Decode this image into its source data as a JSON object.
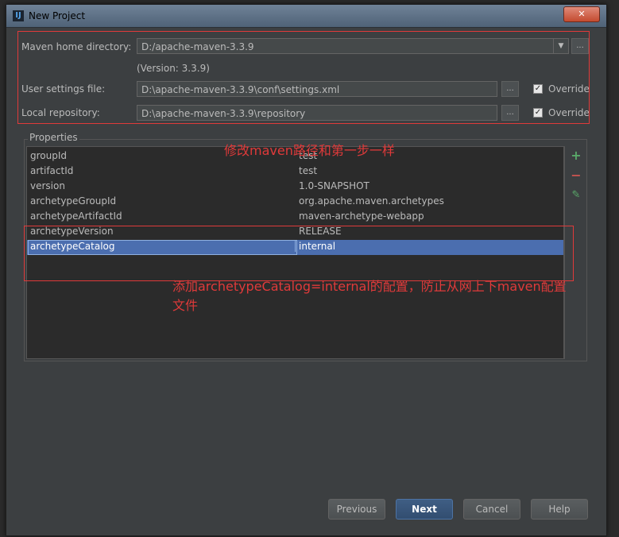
{
  "window": {
    "title": "New Project",
    "app_icon": "IJ",
    "close_label": "✕"
  },
  "maven": {
    "home_label": "Maven home directory:",
    "home_value": "D:/apache-maven-3.3.9",
    "version_text": "(Version: 3.3.9)",
    "settings_label": "User settings file:",
    "settings_value": "D:\\apache-maven-3.3.9\\conf\\settings.xml",
    "repo_label": "Local repository:",
    "repo_value": "D:\\apache-maven-3.3.9\\repository",
    "override_label": "Override",
    "browse_label": "...",
    "dropdown_icon": "▼"
  },
  "properties": {
    "title": "Properties",
    "rows": [
      {
        "key": "groupId",
        "value": "test"
      },
      {
        "key": "artifactId",
        "value": "test"
      },
      {
        "key": "version",
        "value": "1.0-SNAPSHOT"
      },
      {
        "key": "archetypeGroupId",
        "value": "org.apache.maven.archetypes"
      },
      {
        "key": "archetypeArtifactId",
        "value": "maven-archetype-webapp"
      },
      {
        "key": "archetypeVersion",
        "value": "RELEASE"
      },
      {
        "key": "archetypeCatalog",
        "value": "internal"
      }
    ],
    "add_icon": "+",
    "remove_icon": "−",
    "edit_icon": "✎"
  },
  "annotations": {
    "note1": "修改maven路径和第一步一样",
    "note2_line1": "添加archetypeCatalog=internal的配置，防止从网上下maven配置",
    "note2_line2": "文件"
  },
  "buttons": {
    "previous": "Previous",
    "next": "Next",
    "cancel": "Cancel",
    "help": "Help"
  },
  "colors": {
    "accent_selection": "#4b6eaf",
    "annotation_red": "#e03a3a",
    "add_green": "#59a869",
    "remove_red": "#c75450"
  }
}
